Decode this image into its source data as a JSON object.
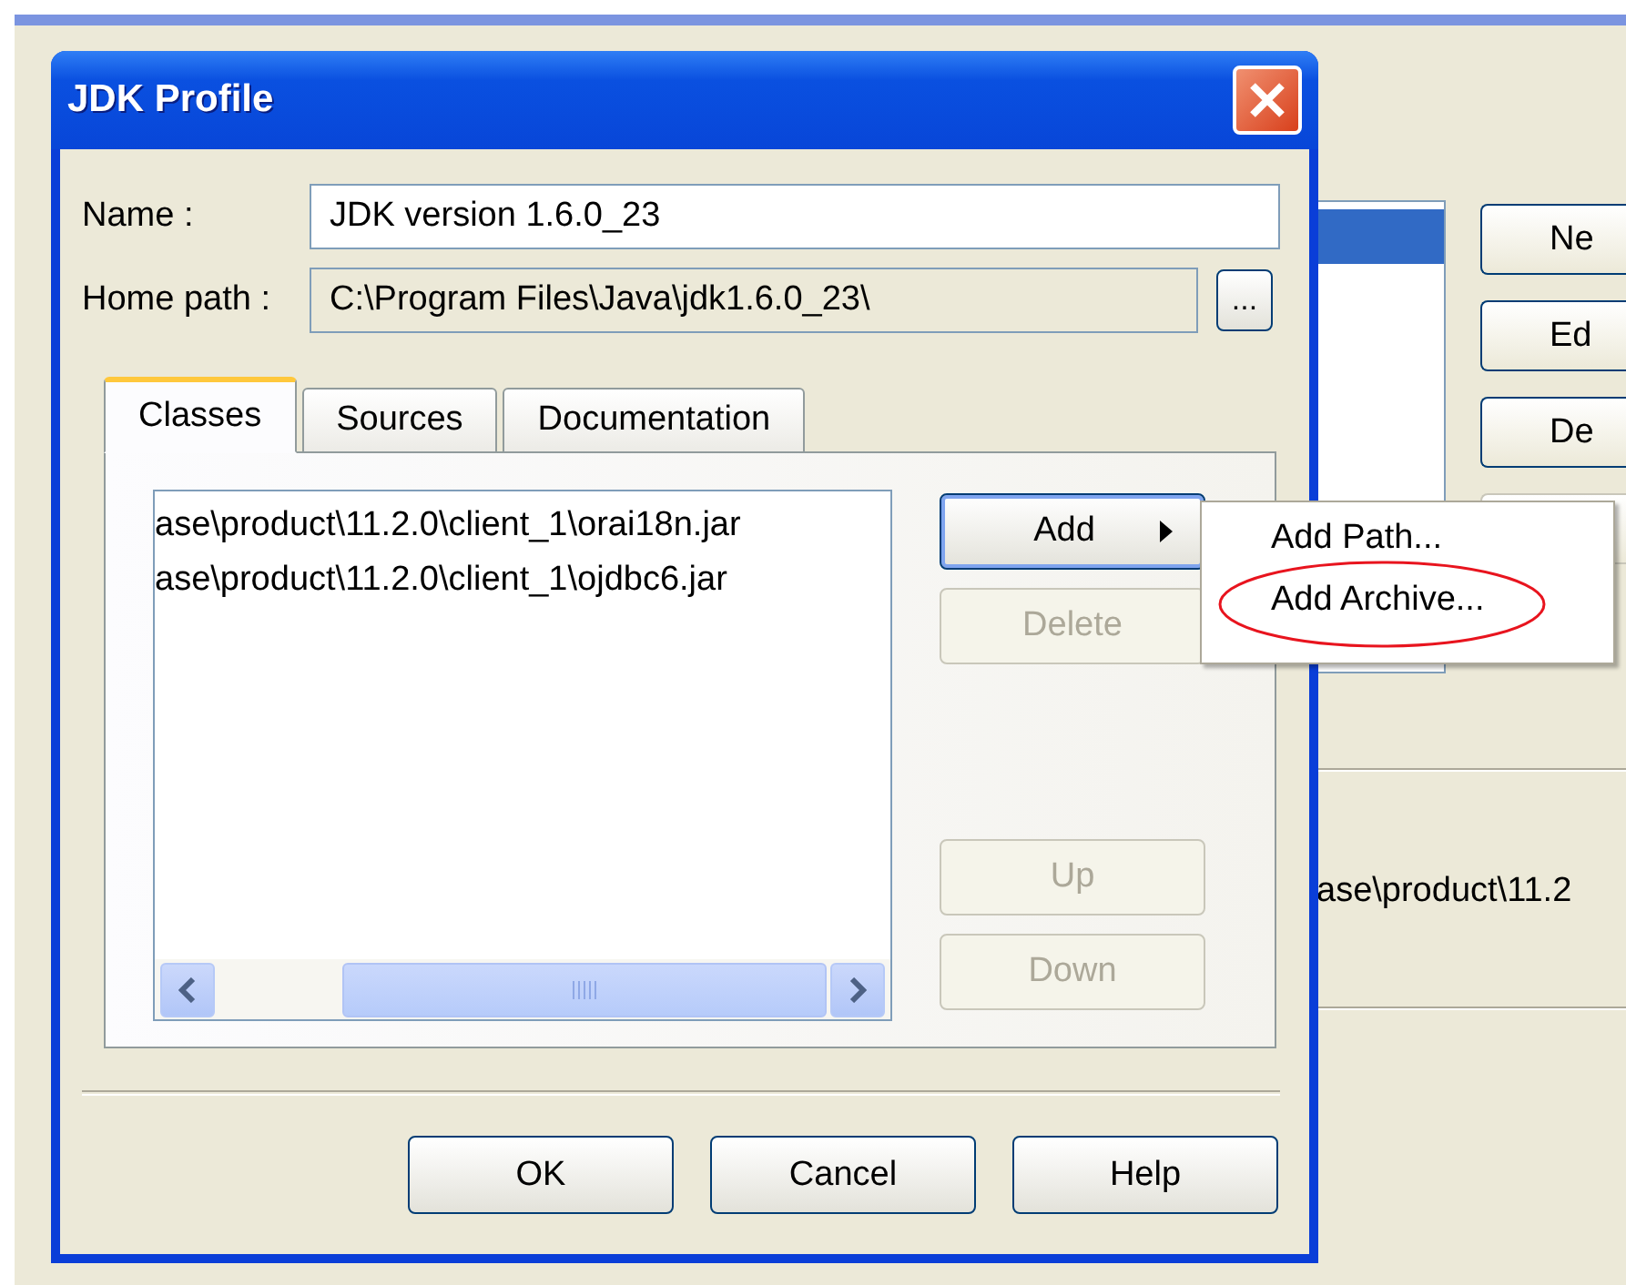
{
  "background_window": {
    "list_rows": [
      {
        "selected": true
      }
    ],
    "buttons": [
      {
        "label": "Ne",
        "disabled": false
      },
      {
        "label": "Ed",
        "disabled": false
      },
      {
        "label": "De",
        "disabled": false
      },
      {
        "disabled": true
      }
    ],
    "path_text": "ase\\product\\11.2"
  },
  "dialog": {
    "title": "JDK Profile",
    "name_label": "Name :",
    "name_value": "JDK version 1.6.0_23",
    "home_path_label": "Home path :",
    "home_path_value": "C:\\Program Files\\Java\\jdk1.6.0_23\\",
    "browse_button": "...",
    "tabs": [
      {
        "label": "Classes",
        "selected": true
      },
      {
        "label": "Sources",
        "selected": false
      },
      {
        "label": "Documentation",
        "selected": false
      }
    ],
    "classes": [
      "ase\\product\\11.2.0\\client_1\\orai18n.jar",
      "ase\\product\\11.2.0\\client_1\\ojdbc6.jar"
    ],
    "side_buttons": [
      {
        "label": "Add",
        "disabled": false,
        "submenu": true
      },
      {
        "label": "Delete",
        "disabled": true,
        "submenu": false
      },
      {
        "label": "Up",
        "disabled": true,
        "submenu": false
      },
      {
        "label": "Down",
        "disabled": true,
        "submenu": false
      }
    ],
    "add_menu": [
      {
        "label": "Add Path...",
        "circled": false
      },
      {
        "label": "Add Archive...",
        "circled": true
      }
    ],
    "footer_buttons": [
      "OK",
      "Cancel",
      "Help"
    ]
  }
}
